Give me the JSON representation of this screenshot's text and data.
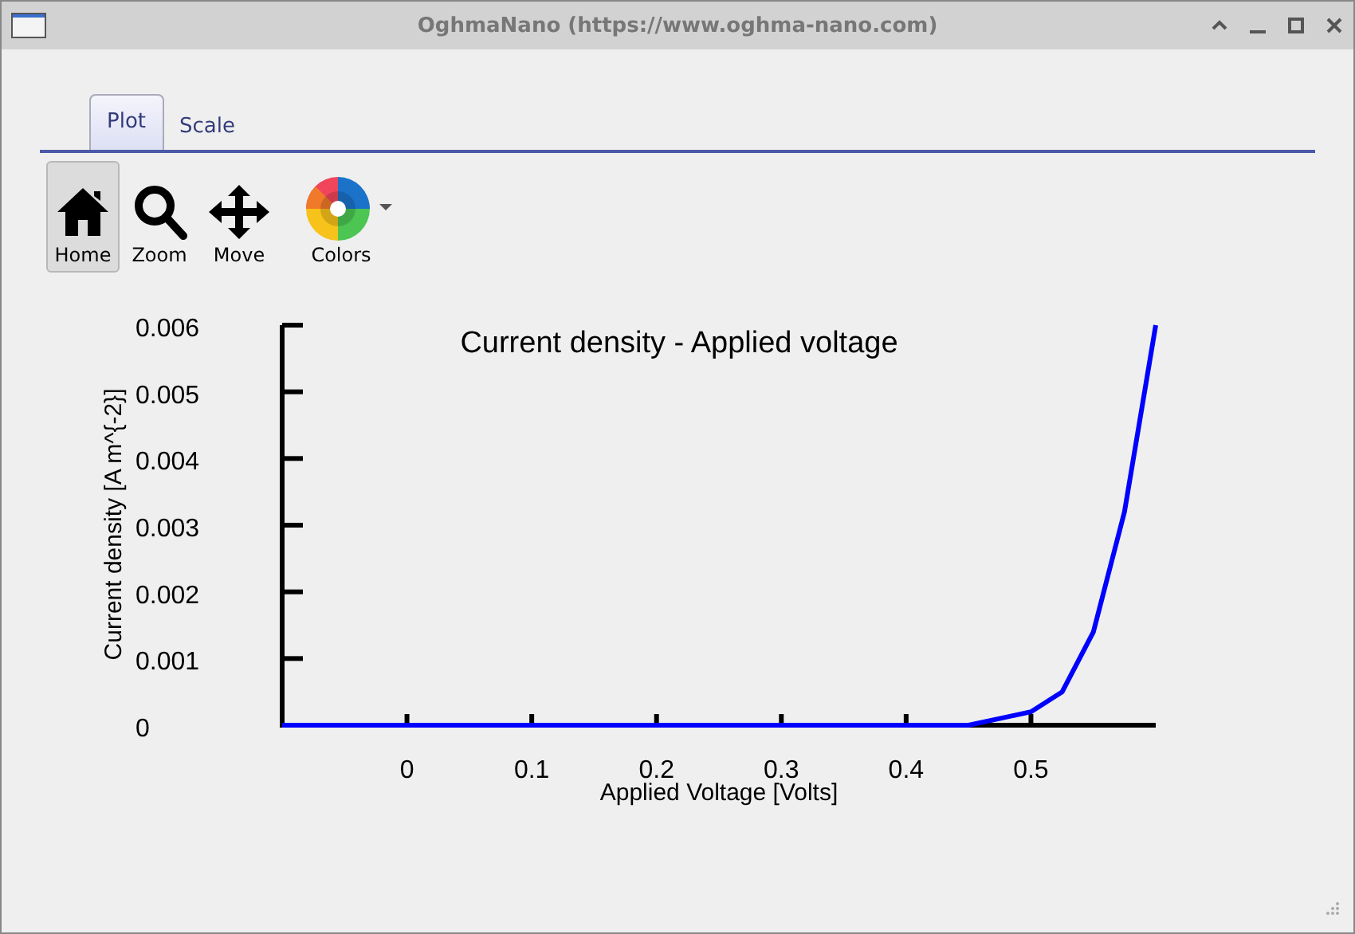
{
  "window": {
    "title": "OghmaNano (https://www.oghma-nano.com)"
  },
  "tabs": [
    {
      "label": "Plot",
      "selected": true
    },
    {
      "label": "Scale",
      "selected": false
    }
  ],
  "toolbar": [
    {
      "label": "Home",
      "kind": "home",
      "selected": true
    },
    {
      "label": "Zoom",
      "kind": "zoom",
      "selected": false
    },
    {
      "label": "Move",
      "kind": "move",
      "selected": false
    },
    {
      "label": "Colors",
      "kind": "colors",
      "selected": false
    }
  ],
  "chart_data": {
    "type": "line",
    "title": "Current density - Applied voltage",
    "xlabel": "Applied Voltage [Volts]",
    "ylabel": "Current density [A m^{-2}]",
    "x": [
      -0.1,
      0,
      0.1,
      0.2,
      0.3,
      0.4,
      0.45,
      0.475,
      0.5,
      0.525,
      0.55,
      0.575,
      0.6
    ],
    "series": [
      {
        "color": "#0000ff",
        "values": [
          0,
          0,
          0,
          0,
          0,
          0,
          0,
          0.0001,
          0.0002,
          0.0005,
          0.0014,
          0.0032,
          0.006
        ]
      }
    ],
    "xlim": [
      -0.1,
      0.6
    ],
    "ylim": [
      0,
      0.006
    ],
    "xticks": [
      0,
      0.1,
      0.2,
      0.3,
      0.4,
      0.5
    ],
    "yticks": [
      {
        "value": 0,
        "label": "0"
      },
      {
        "value": 0.001,
        "label": "0.001"
      },
      {
        "value": 0.002,
        "label": "0.002"
      },
      {
        "value": 0.003,
        "label": "0.003"
      },
      {
        "value": 0.004,
        "label": "0.004"
      },
      {
        "value": 0.005,
        "label": "0.005"
      },
      {
        "value": 0.006,
        "label": "0.006"
      }
    ]
  }
}
